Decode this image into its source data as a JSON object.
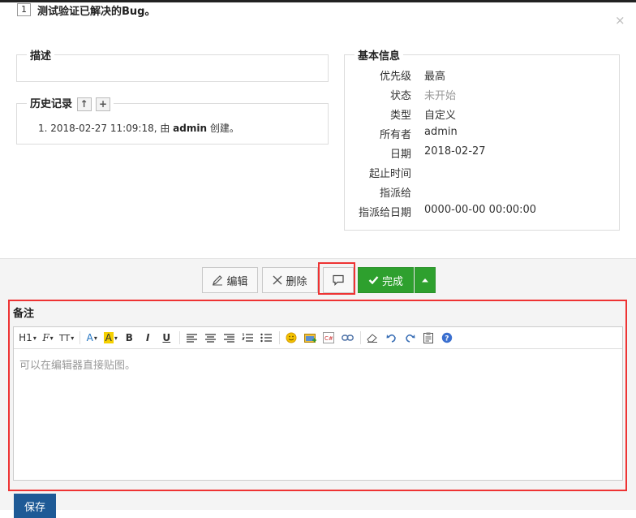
{
  "header": {
    "id": "1",
    "title": "测试验证已解决的Bug。",
    "close": "×"
  },
  "desc": {
    "legend": "描述"
  },
  "history": {
    "legend": "历史记录",
    "up_btn": "↑",
    "add_btn": "+",
    "item_prefix": "1. 2018-02-27 11:09:18, 由 ",
    "item_user": "admin",
    "item_suffix": " 创建。"
  },
  "info": {
    "legend": "基本信息",
    "rows": [
      {
        "label": "优先级",
        "value": "最高"
      },
      {
        "label": "状态",
        "value": "未开始"
      },
      {
        "label": "类型",
        "value": "自定义"
      },
      {
        "label": "所有者",
        "value": "admin"
      },
      {
        "label": "日期",
        "value": "2018-02-27"
      },
      {
        "label": "起止时间",
        "value": ""
      },
      {
        "label": "指派给",
        "value": ""
      },
      {
        "label": "指派给日期",
        "value": "0000-00-00 00:00:00"
      }
    ]
  },
  "actions": {
    "edit": "编辑",
    "delete": "删除",
    "done": "完成"
  },
  "note": {
    "label": "备注",
    "placeholder": "可以在编辑器直接贴图。",
    "toolbar": {
      "h1": "H1",
      "font": "F",
      "size": "TT",
      "color": "A",
      "bg": "A",
      "bold": "B",
      "italic": "I",
      "underline": "U"
    }
  },
  "save": "保存",
  "colors": {
    "accent_green": "#2ea02e",
    "highlight_red": "#ee3333",
    "save_blue": "#1e5a96"
  }
}
